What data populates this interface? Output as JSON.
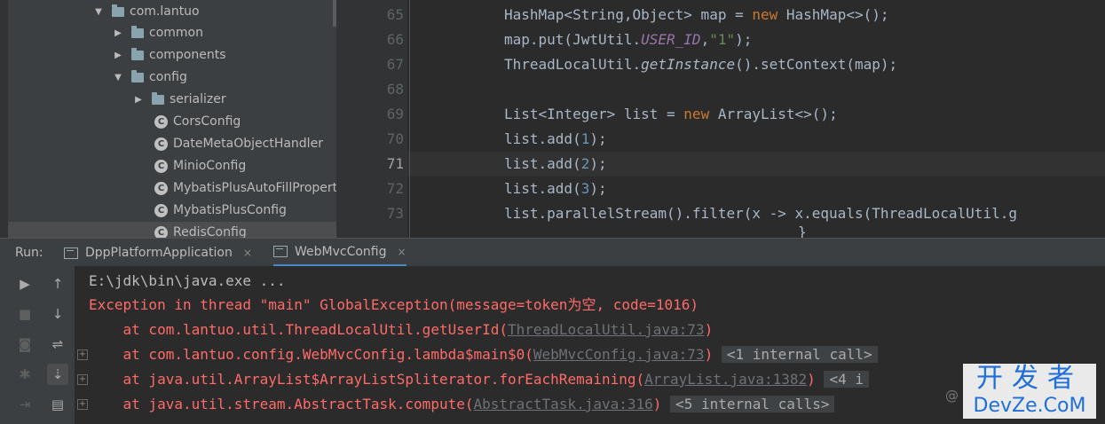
{
  "project_tree": {
    "items": [
      {
        "label": "com.lantuo",
        "type": "package",
        "expanded": true
      },
      {
        "label": "common",
        "type": "package",
        "expanded": false
      },
      {
        "label": "components",
        "type": "package",
        "expanded": false
      },
      {
        "label": "config",
        "type": "package",
        "expanded": true
      },
      {
        "label": "serializer",
        "type": "package",
        "expanded": false
      },
      {
        "label": "CorsConfig",
        "type": "class"
      },
      {
        "label": "DateMetaObjectHandler",
        "type": "class"
      },
      {
        "label": "MinioConfig",
        "type": "class"
      },
      {
        "label": "MybatisPlusAutoFillPropert",
        "type": "class"
      },
      {
        "label": "MybatisPlusConfig",
        "type": "class"
      },
      {
        "label": "RedisConfig",
        "type": "class"
      }
    ]
  },
  "editor": {
    "line_numbers": [
      "65",
      "66",
      "67",
      "68",
      "69",
      "70",
      "71",
      "72",
      "73"
    ],
    "current_line": "71",
    "closing_brace": "}"
  },
  "run_panel": {
    "label": "Run:",
    "tabs": [
      {
        "label": "DppPlatformApplication",
        "active": false
      },
      {
        "label": "WebMvcConfig",
        "active": true
      }
    ],
    "close_glyph": "×"
  },
  "console": {
    "command": "E:\\jdk\\bin\\java.exe ...",
    "exception": "Exception in thread \"main\" GlobalException(message=token为空, code=1016)",
    "frames": [
      {
        "prefix": "    at com.lantuo.util.ThreadLocalUtil.getUserId(",
        "link": "ThreadLocalUtil.java:73",
        "suffix": ")",
        "internal": ""
      },
      {
        "prefix": "    at com.lantuo.config.WebMvcConfig.lambda$main$0(",
        "link": "WebMvcConfig.java:73",
        "suffix": ")",
        "internal": "<1 internal call>"
      },
      {
        "prefix": "    at java.util.ArrayList$ArrayListSpliterator.forEachRemaining(",
        "link": "ArrayList.java:1382",
        "suffix": ")",
        "internal": "<4 i"
      },
      {
        "prefix": "    at java.util.stream.AbstractTask.compute(",
        "link": "AbstractTask.java:316",
        "suffix": ")",
        "internal": "<5 internal calls>"
      }
    ]
  },
  "watermark": {
    "top": "开发者",
    "bottom": "DevZe.CoM",
    "at": "@"
  },
  "colors": {
    "error": "#ff6b68",
    "keyword": "#cc7832",
    "background": "#2b2b2b",
    "panel": "#3c3f41"
  }
}
